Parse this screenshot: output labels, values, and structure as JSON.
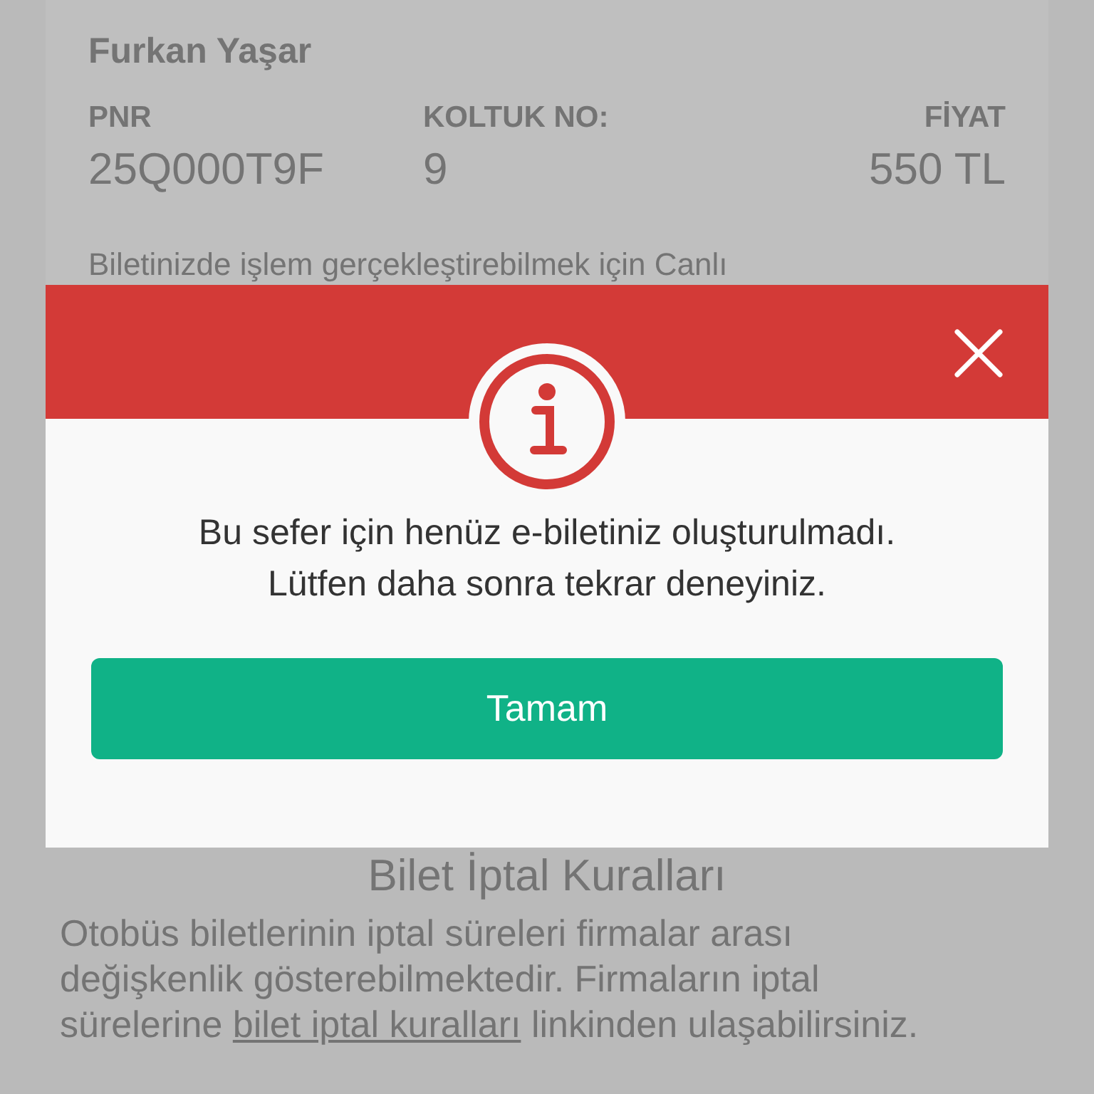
{
  "ticket": {
    "passenger": "Furkan Yaşar",
    "fields": [
      {
        "label": "PNR",
        "value": "25Q000T9F"
      },
      {
        "label": "KOLTUK NO:",
        "value": "9"
      },
      {
        "label": "FİYAT",
        "value": "550 TL"
      }
    ],
    "notice": "Biletinizde işlem gerçekleştirebilmek için Canlı"
  },
  "rules": {
    "heading": "Bilet İptal Kuralları",
    "text_before": "Otobüs biletlerinin iptal süreleri firmalar arası değişkenlik gösterebilmektedir. Firmaların iptal sürelerine",
    "link": "bilet iptal kuralları",
    "text_after": "linkinden ulaşabilirsiniz."
  },
  "dialog": {
    "message": [
      "Bu sefer için henüz e-biletiniz oluşturulmadı.",
      "Lütfen daha sonra tekrar deneyiniz."
    ],
    "button": "Tamam"
  }
}
